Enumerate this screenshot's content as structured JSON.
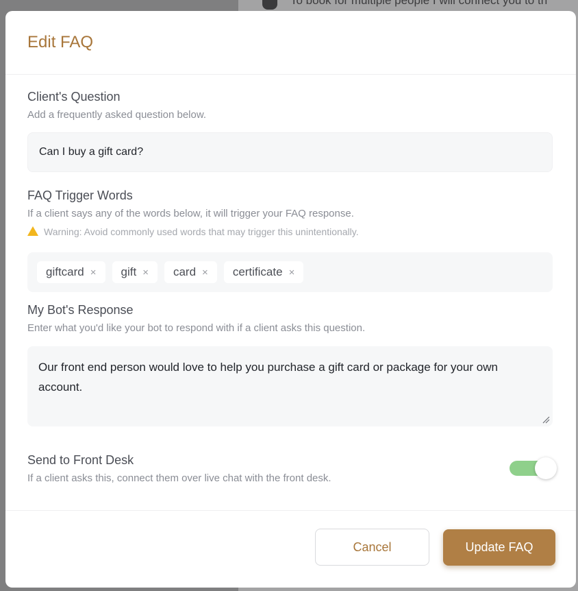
{
  "background": {
    "chat_text": "To book for multiple people I will connect you to th"
  },
  "modal": {
    "title": "Edit FAQ",
    "question": {
      "title": "Client's Question",
      "description": "Add a frequently asked question below.",
      "value": "Can I buy a gift card?"
    },
    "triggers": {
      "title": "FAQ Trigger Words",
      "description": "If a client says any of the words below, it will trigger your FAQ response.",
      "warning": "Warning: Avoid commonly used words that may trigger this unintentionally.",
      "tags": [
        "giftcard",
        "gift",
        "card",
        "certificate"
      ],
      "remove_glyph": "×"
    },
    "response": {
      "title": "My Bot's Response",
      "description": "Enter what you'd like your bot to respond with if a client asks this question.",
      "value": "Our front end person would love to help you purchase a gift card or package for your own account."
    },
    "front_desk": {
      "title": "Send to Front Desk",
      "description": "If a client asks this, connect them over live chat with the front desk.",
      "enabled": true
    },
    "buttons": {
      "cancel": "Cancel",
      "update": "Update FAQ"
    }
  },
  "colors": {
    "accent": "#b07f45",
    "title": "#a8763a",
    "toggle_on": "#8fd08b",
    "warning": "#f2b61e"
  }
}
